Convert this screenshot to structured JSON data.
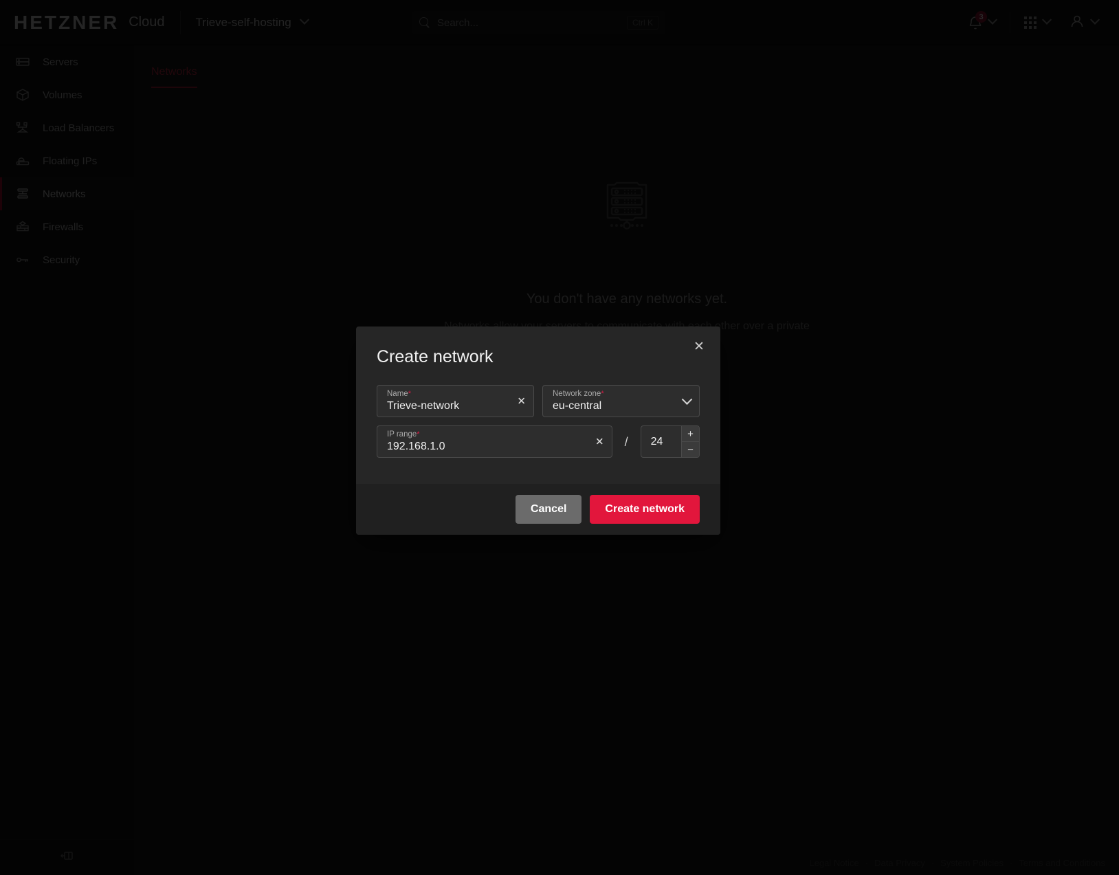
{
  "header": {
    "brand_name": "HETZNER",
    "brand_product": "Cloud",
    "project": "Trieve-self-hosting",
    "search_placeholder": "Search...",
    "search_shortcut": "Ctrl K",
    "notification_count": "3"
  },
  "sidebar": {
    "items": [
      {
        "label": "Servers",
        "icon": "server-icon",
        "active": false
      },
      {
        "label": "Volumes",
        "icon": "volume-icon",
        "active": false
      },
      {
        "label": "Load Balancers",
        "icon": "load-balancer-icon",
        "active": false
      },
      {
        "label": "Floating IPs",
        "icon": "floating-ip-icon",
        "active": false
      },
      {
        "label": "Networks",
        "icon": "network-icon",
        "active": true
      },
      {
        "label": "Firewalls",
        "icon": "firewall-icon",
        "active": false
      },
      {
        "label": "Security",
        "icon": "key-icon",
        "active": false
      }
    ],
    "collapse_icon": "collapse-panel-icon"
  },
  "main": {
    "tab_label": "Networks",
    "empty_icon": "network-server-icon",
    "empty_title": "You don't have any networks yet.",
    "empty_subtitle": "Networks allow your servers to communicate with each other over a private network."
  },
  "footer": {
    "links": [
      "Legal Notice",
      "Data Privacy",
      "System Policies",
      "Terms and Conditions"
    ],
    "separator": "·"
  },
  "modal": {
    "title": "Create network",
    "close_icon": "close-icon",
    "fields": {
      "name": {
        "label": "Name",
        "required_marker": "*",
        "value": "Trieve-network",
        "clear_icon": "clear-icon"
      },
      "zone": {
        "label": "Network zone",
        "required_marker": "*",
        "value": "eu-central",
        "chevron_icon": "chevron-down-icon"
      },
      "ip_range": {
        "label": "IP range",
        "required_marker": "*",
        "value": "192.168.1.0",
        "clear_icon": "clear-icon"
      },
      "cidr": {
        "value": "24",
        "separator": "/",
        "increment_label": "+",
        "decrement_label": "−"
      }
    },
    "cancel_label": "Cancel",
    "submit_label": "Create network"
  },
  "colors": {
    "accent_red": "#e2163c",
    "tab_red": "#c22a45",
    "badge_red": "#8e1330",
    "panel_bg": "#262626",
    "page_bg": "#0b0b0b"
  }
}
